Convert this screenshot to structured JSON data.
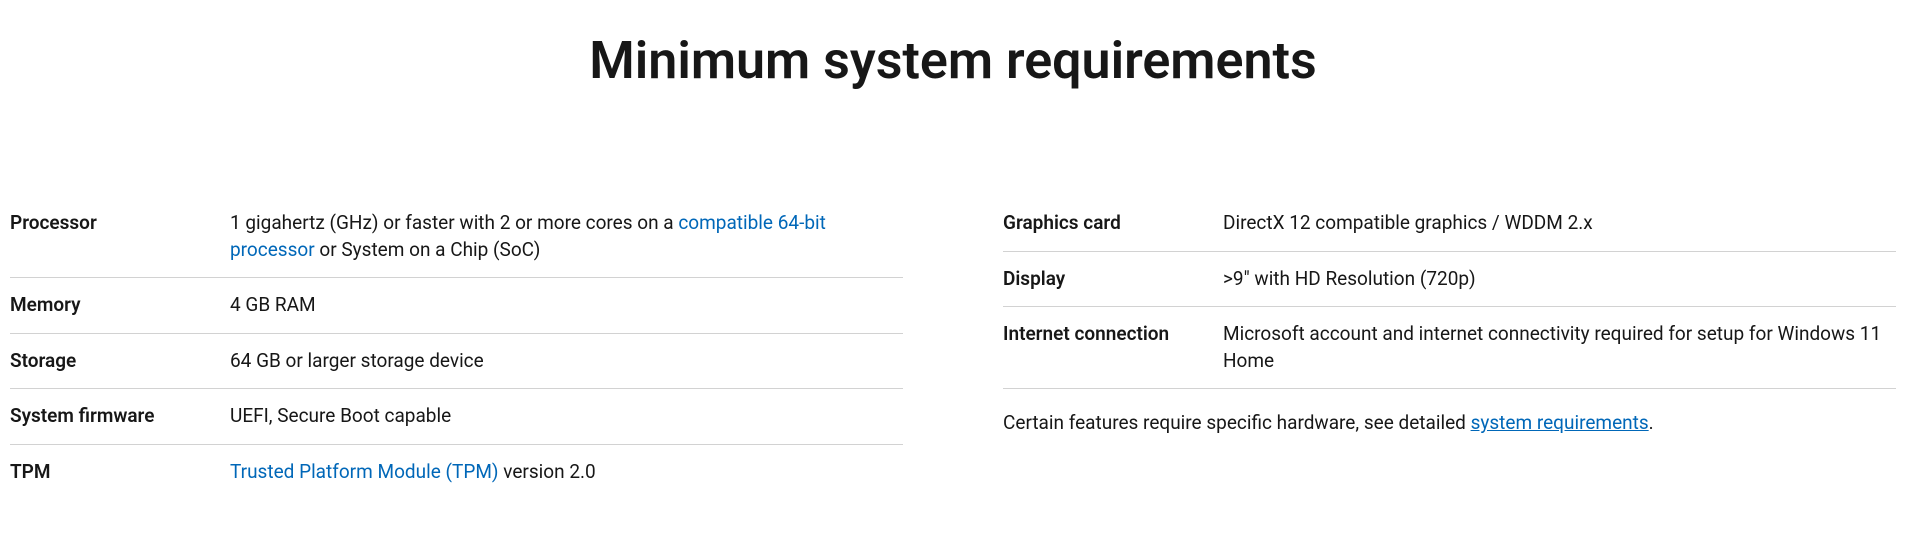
{
  "title": "Minimum system requirements",
  "left": {
    "processor": {
      "label": "Processor",
      "value_prefix": "1 gigahertz (GHz) or faster with 2 or more cores on a ",
      "link_text": "compatible 64-bit processor",
      "value_suffix": " or System on a Chip (SoC)"
    },
    "memory": {
      "label": "Memory",
      "value": "4 GB RAM"
    },
    "storage": {
      "label": "Storage",
      "value": "64 GB or larger storage device"
    },
    "firmware": {
      "label": "System firmware",
      "value": "UEFI, Secure Boot capable"
    },
    "tpm": {
      "label": "TPM",
      "link_text": "Trusted Platform Module (TPM)",
      "value_suffix": " version 2.0"
    }
  },
  "right": {
    "graphics": {
      "label": "Graphics card",
      "value": "DirectX 12 compatible graphics / WDDM 2.x"
    },
    "display": {
      "label": "Display",
      "value": ">9\" with HD Resolution (720p)"
    },
    "internet": {
      "label": "Internet connection",
      "value": "Microsoft account and internet connectivity required for setup for Windows 11 Home"
    }
  },
  "footnote": {
    "prefix": "Certain features require specific hardware, see detailed ",
    "link_text": "system requirements",
    "suffix": "."
  }
}
